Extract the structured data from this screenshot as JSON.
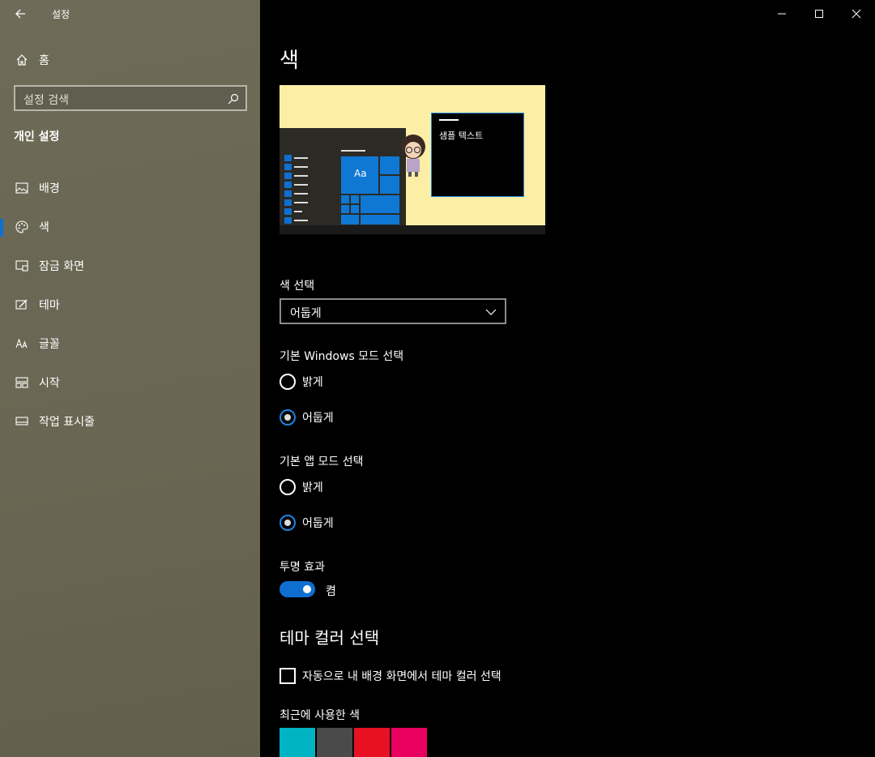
{
  "app": {
    "title": "설정"
  },
  "sidebar": {
    "home_label": "홈",
    "search_placeholder": "설정 검색",
    "section_title": "개인 설정",
    "items": [
      {
        "label": "배경",
        "icon": "picture-icon"
      },
      {
        "label": "색",
        "icon": "palette-icon",
        "active": true
      },
      {
        "label": "잠금 화면",
        "icon": "lock-screen-icon"
      },
      {
        "label": "테마",
        "icon": "theme-brush-icon"
      },
      {
        "label": "글꼴",
        "icon": "font-icon"
      },
      {
        "label": "시작",
        "icon": "start-grid-icon"
      },
      {
        "label": "작업 표시줄",
        "icon": "taskbar-icon"
      }
    ]
  },
  "main": {
    "page_title": "색",
    "preview": {
      "tile_label": "Aa",
      "sample_text": "샘플 텍스트"
    },
    "color_choice": {
      "label": "색 선택",
      "value": "어둡게"
    },
    "windows_mode": {
      "label": "기본 Windows 모드 선택",
      "options": [
        {
          "label": "밝게",
          "checked": false
        },
        {
          "label": "어둡게",
          "checked": true
        }
      ]
    },
    "app_mode": {
      "label": "기본 앱 모드 선택",
      "options": [
        {
          "label": "밝게",
          "checked": false
        },
        {
          "label": "어둡게",
          "checked": true
        }
      ]
    },
    "transparency": {
      "label": "투명 효과",
      "state_label": "켬",
      "on": true
    },
    "accent": {
      "heading": "테마 컬러 선택",
      "auto_pick_label": "자동으로 내 배경 화면에서 테마 컬러 선택",
      "recent_label": "최근에 사용한 색",
      "recent_colors": [
        "#00b4c4",
        "#4a4a4a",
        "#e81123",
        "#ea005e"
      ]
    }
  },
  "colors": {
    "accent": "#0f6fd0",
    "sidebar_bg": "#6b6855",
    "preview_bg": "#fdeea6"
  }
}
